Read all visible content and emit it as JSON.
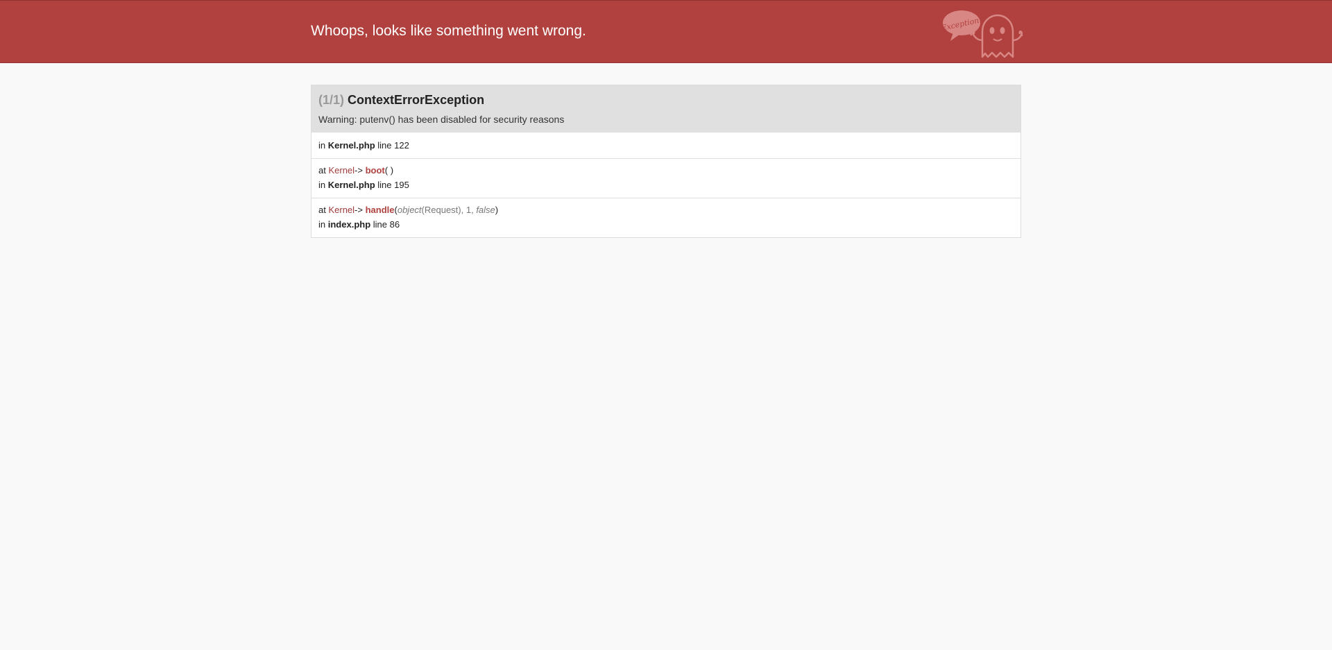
{
  "header": {
    "title": "Whoops, looks like something went wrong.",
    "logo_text": "Exception!",
    "brand_color": "#b0413e"
  },
  "exception": {
    "count": "(1/1)",
    "name": "ContextErrorException",
    "message": "Warning: putenv() has been disabled for security reasons"
  },
  "trace": [
    {
      "in_label": "in",
      "file": "Kernel.php",
      "line_label": "line",
      "line": "122"
    },
    {
      "at_label": "at",
      "class": "Kernel",
      "arrow": "->",
      "function": "boot",
      "open_paren": "(",
      "close_paren": ")",
      "in_label": "in",
      "file": "Kernel.php",
      "line_label": "line",
      "line": "195"
    },
    {
      "at_label": "at",
      "class": "Kernel",
      "arrow": "->",
      "function": "handle",
      "open_paren": "(",
      "args": {
        "a1_type": "object",
        "a1_value": "(Request), 1, ",
        "a2": "false"
      },
      "close_paren": ")",
      "in_label": "in",
      "file": "index.php",
      "line_label": "line",
      "line": "86"
    }
  ]
}
